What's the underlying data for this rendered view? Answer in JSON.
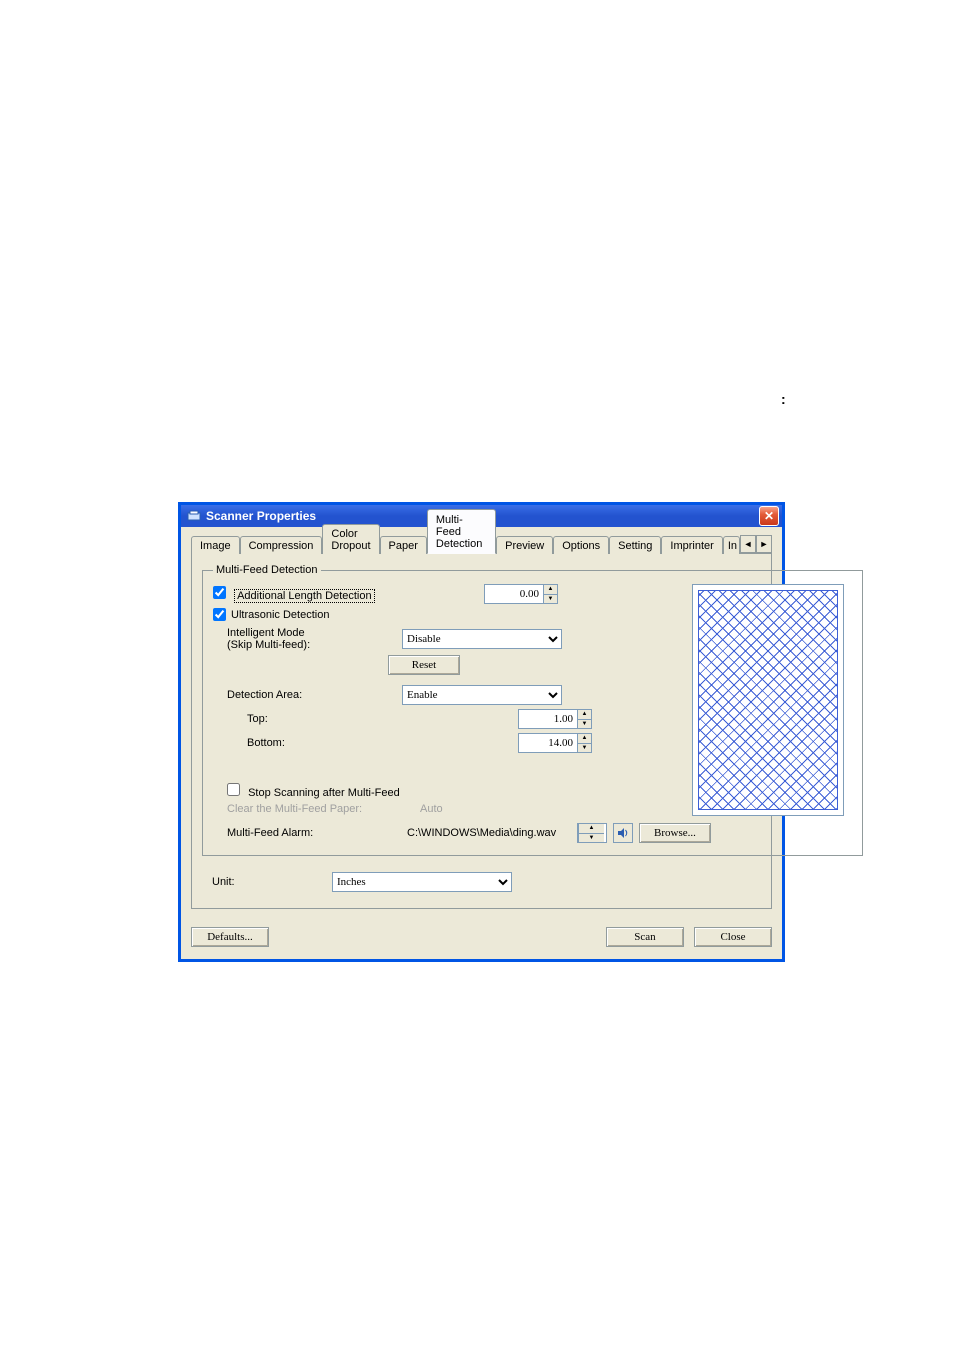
{
  "window": {
    "title": "Scanner Properties"
  },
  "tabs": [
    "Image",
    "Compression",
    "Color Dropout",
    "Paper",
    "Multi-Feed Detection",
    "Preview",
    "Options",
    "Setting",
    "Imprinter",
    "In"
  ],
  "group": {
    "legend": "Multi-Feed Detection",
    "additional_length_label": "Additional Length Detection",
    "additional_length_value": "0.00",
    "ultrasonic_label": "Ultrasonic Detection",
    "intelligent_mode_label_line1": "Intelligent Mode",
    "intelligent_mode_label_line2": "(Skip Multi-feed):",
    "intelligent_mode_value": "Disable",
    "reset_label": "Reset",
    "detection_area_label": "Detection Area:",
    "detection_area_value": "Enable",
    "top_label": "Top:",
    "top_value": "1.00",
    "bottom_label": "Bottom:",
    "bottom_value": "14.00",
    "stop_scanning_label": "Stop Scanning after Multi-Feed",
    "clear_paper_label": "Clear the Multi-Feed Paper:",
    "clear_paper_value": "Auto",
    "alarm_label": "Multi-Feed Alarm:",
    "alarm_path": "C:\\WINDOWS\\Media\\ding.wav",
    "browse_label": "Browse..."
  },
  "unit": {
    "label": "Unit:",
    "value": "Inches"
  },
  "buttons": {
    "defaults": "Defaults...",
    "scan": "Scan",
    "close": "Close"
  }
}
